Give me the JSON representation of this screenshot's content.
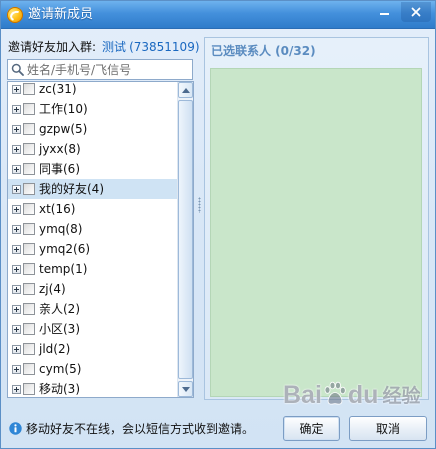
{
  "window": {
    "title": "邀请新成员",
    "app_icon": "fetion-logo-icon",
    "minimize_icon": "minimize-icon",
    "close_icon": "close-icon"
  },
  "invite": {
    "label": "邀请好友加入群:",
    "group_name": "测试",
    "group_id": "(73851109)"
  },
  "search": {
    "placeholder": "姓名/手机号/飞信号",
    "value": "",
    "icon": "search-icon"
  },
  "groups": [
    {
      "text": "zc(31)"
    },
    {
      "text": "工作(10)"
    },
    {
      "text": "gzpw(5)"
    },
    {
      "text": "jyxx(8)"
    },
    {
      "text": "同事(6)"
    },
    {
      "text": "我的好友(4)",
      "highlighted": true
    },
    {
      "text": "xt(16)"
    },
    {
      "text": "ymq(8)"
    },
    {
      "text": "ymq2(6)"
    },
    {
      "text": "temp(1)"
    },
    {
      "text": "zj(4)"
    },
    {
      "text": "亲人(2)"
    },
    {
      "text": "小区(3)"
    },
    {
      "text": "jld(2)"
    },
    {
      "text": "cym(5)"
    },
    {
      "text": "移动(3)"
    }
  ],
  "selected_panel": {
    "title": "已选联系人 (0/32)"
  },
  "footer": {
    "info_icon": "info-icon",
    "notice": "移动好友不在线，会以短信方式收到邀请。",
    "ok_label": "确定",
    "cancel_label": "取消"
  },
  "watermark": {
    "part1": "Bai",
    "icon": "baidu-paw-icon",
    "part2": "du",
    "part3": "经验"
  },
  "colors": {
    "accent": "#1a68c0",
    "panel-title": "#5b8cc0",
    "selected-bg": "#c9e6ca",
    "highlight": "#cfe3f4"
  }
}
